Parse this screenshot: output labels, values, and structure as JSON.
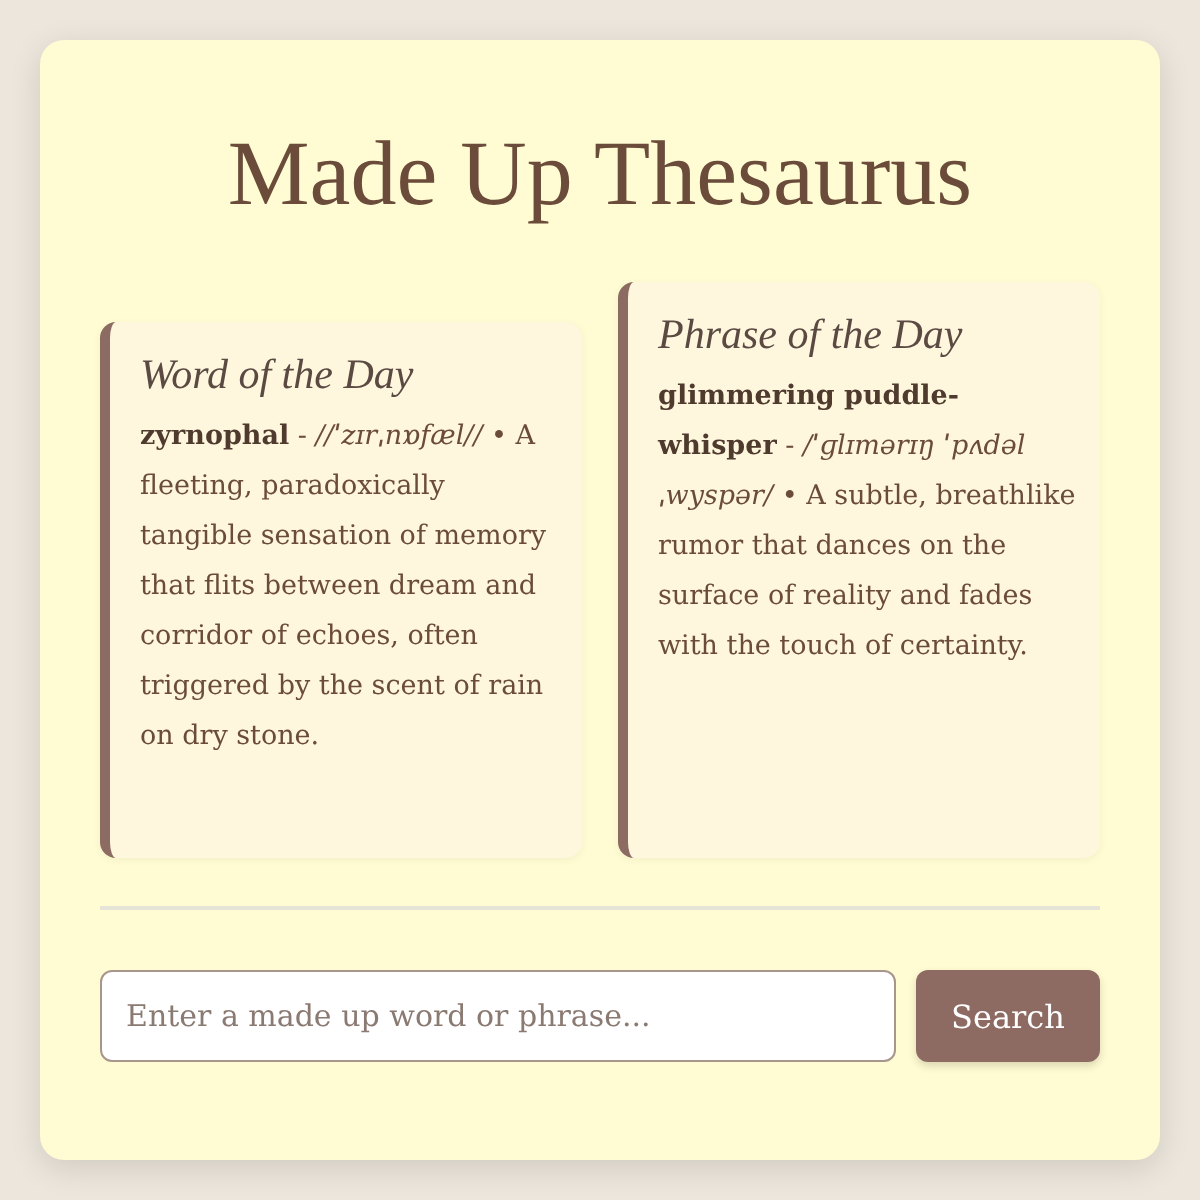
{
  "title": "Made Up Thesaurus",
  "cards": [
    {
      "heading": "Word of the Day",
      "raised": false,
      "entry": "**zyrnophal** - *//ˈzɪrˌnɒfæl//* • A fleeting, paradoxically tangible sensation of memory that flits between dream and corridor of echoes, often triggered by the scent of rain on dry stone."
    },
    {
      "heading": "Phrase of the Day",
      "raised": true,
      "entry": "**glimmering puddle-whisper** - */ˈɡlɪmərɪŋ ˈpʌdəlˌwyspər/* • A subtle, breathlike rumor that dances on the surface of reality and fades with the touch of certainty."
    }
  ],
  "search": {
    "placeholder": "Enter a made up word or phrase...",
    "button": "Search"
  }
}
